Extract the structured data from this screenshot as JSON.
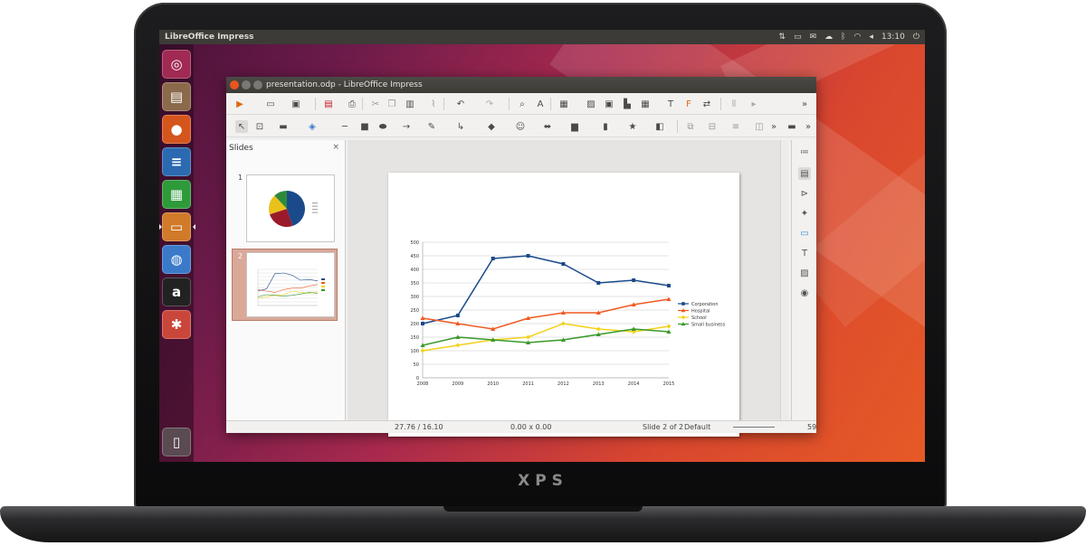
{
  "desktop": {
    "app_name": "LibreOffice Impress",
    "clock": "13:10",
    "indicators": [
      "network-icon",
      "keyboard-icon",
      "mail-icon",
      "cloud-icon",
      "bluetooth-icon",
      "wifi-icon",
      "volume-icon",
      "clock",
      "power-icon"
    ]
  },
  "laptop": {
    "brand": "XPS"
  },
  "launcher": {
    "items": [
      {
        "name": "ubuntu-dash-icon",
        "glyph": "◎",
        "bg": "#a02a53"
      },
      {
        "name": "files-icon",
        "glyph": "▤",
        "bg": "#8a6a4a"
      },
      {
        "name": "firefox-icon",
        "glyph": "●",
        "bg": "#d4561c"
      },
      {
        "name": "writer-icon",
        "glyph": "≡",
        "bg": "#2b6ab0"
      },
      {
        "name": "calc-icon",
        "glyph": "▦",
        "bg": "#2e9a3a"
      },
      {
        "name": "impress-icon",
        "glyph": "▭",
        "bg": "#d07a2a"
      },
      {
        "name": "software-center-icon",
        "glyph": "◍",
        "bg": "#3b7ac9"
      },
      {
        "name": "amazon-icon",
        "glyph": "a",
        "bg": "#222222"
      },
      {
        "name": "system-settings-icon",
        "glyph": "✱",
        "bg": "#c9473a"
      },
      {
        "name": "trash-icon",
        "glyph": "▯",
        "bg": "#5a4a52"
      }
    ]
  },
  "window": {
    "title": "presentation.odp - LibreOffice Impress",
    "slides_pane": {
      "header": "Slides",
      "close": "×",
      "thumbs": [
        {
          "number": "1"
        },
        {
          "number": "2"
        }
      ]
    },
    "status": {
      "position": "27.76 / 16.10",
      "size": "0.00 x 0.00",
      "slide": "Slide 2 of 2",
      "layout": "Default",
      "zoom": "59"
    }
  },
  "chart_data": {
    "type": "line",
    "x": [
      "2008",
      "2009",
      "2010",
      "2011",
      "2012",
      "2013",
      "2014",
      "2015"
    ],
    "ylim": [
      0,
      500
    ],
    "yticks": [
      "0",
      "50",
      "100",
      "150",
      "200",
      "250",
      "300",
      "350",
      "400",
      "450",
      "500"
    ],
    "grid": true,
    "legend_position": "right",
    "series": [
      {
        "name": "Corporation",
        "color": "#1a4a8a",
        "marker": "square",
        "values": [
          200,
          230,
          440,
          450,
          420,
          350,
          360,
          340
        ]
      },
      {
        "name": "Hospital",
        "color": "#f05a22",
        "marker": "triangle",
        "values": [
          220,
          200,
          180,
          220,
          240,
          240,
          270,
          290
        ]
      },
      {
        "name": "School",
        "color": "#f2d21a",
        "marker": "diamond",
        "values": [
          100,
          120,
          140,
          150,
          200,
          180,
          170,
          190
        ]
      },
      {
        "name": "Small business",
        "color": "#3a9a2a",
        "marker": "triangle",
        "values": [
          120,
          150,
          140,
          130,
          140,
          160,
          180,
          170
        ]
      }
    ]
  },
  "slide1_pie": {
    "values": [
      45,
      25,
      18,
      12
    ],
    "colors": [
      "#1a4a8a",
      "#9a1a2a",
      "#e8c21a",
      "#2e8a3a"
    ]
  }
}
